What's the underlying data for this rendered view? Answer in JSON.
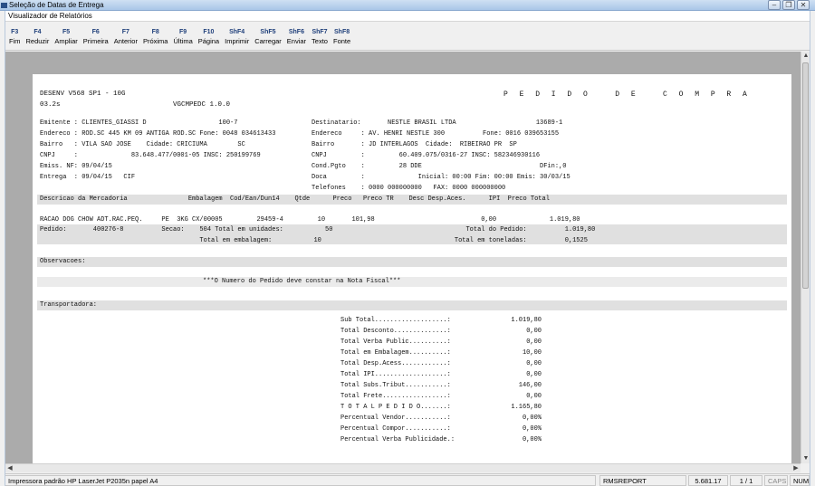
{
  "outer_title": "Seleção de Datas de Entrega",
  "window_title": "Visualizador de Relatórios",
  "toolbar": [
    {
      "key": "F3",
      "label": "Fim"
    },
    {
      "key": "F4",
      "label": "Reduzir"
    },
    {
      "key": "F5",
      "label": "Ampliar"
    },
    {
      "key": "F6",
      "label": "Primeira"
    },
    {
      "key": "F7",
      "label": "Anterior"
    },
    {
      "key": "F8",
      "label": "Próxima"
    },
    {
      "key": "F9",
      "label": "Última"
    },
    {
      "key": "F10",
      "label": "Página"
    },
    {
      "key": "ShF4",
      "label": "Imprimir"
    },
    {
      "key": "ShF5",
      "label": "Carregar"
    },
    {
      "key": "ShF6",
      "label": "Enviar"
    },
    {
      "key": "ShF7",
      "label": "Texto"
    },
    {
      "key": "ShF8",
      "label": "Fonte"
    }
  ],
  "report": {
    "system": "DESENV V568 SP1 - 10G",
    "version": "03.2s",
    "program": "VGCMPEDC 1.0.0",
    "doc_title": "P E D I D O   D E   C O M P R A",
    "emitente_line": "Emitente : CLIENTES_GIASSI D                   100-7",
    "endereco_line": "Endereco : ROD.SC 445 KM 09 ANTIGA ROD.SC Fone: 0048 034613433",
    "bairro_line": "Bairro   : VILA SAO JOSE    Cidade: CRICIUMA        SC",
    "cnpj_line": "CNPJ     :              83.648.477/0001-05 INSC: 250199769",
    "emiss_line": "Emiss. NF: 09/04/15",
    "entrega_line": "Entrega  : 09/04/15   CIF",
    "dest_line": "Destinatario:       NESTLE BRASIL LTDA                     13689-1",
    "dest_end_line": "Endereco     : AV. HENRI NESTLE 300          Fone: 0016 039653155",
    "dest_bairro_line": "Bairro       : JD INTERLAGOS  Cidade:  RIBEIRAO PR  SP",
    "dest_cnpj_line": "CNPJ         :         60.409.075/0316-27 INSC: 582346930116",
    "condpgto_line": "Cond.Pgto    :         28 DDE                               DFin:,0",
    "doca_line": "Doca         :              Inicial: 00:00 Fim: 00:00 Emis: 30/03/15",
    "telefones_line": "Telefones    : 0000 000000000   FAX: 0000 000000000",
    "columns_line": "Descricao da Mercadoria                Embalagem  Cod/Ean/Dun14    Qtde      Preco   Preco TR    Desc Desp.Aces.      IPI  Preco Total",
    "item_line": "RACAO DOG CHOW ADT.RAC.PEQ.     PE  3KG CX/00005         29459-4         10       101,98                            0,00              1.019,80",
    "pedido_line": "Pedido:       400276-8          Secao:    504 Total em unidades:           50                                   Total do Pedido:          1.019,80",
    "embalagem_line": "                                          Total em embalagem:           10                                   Total em toneladas:          0,1525",
    "obs_label": "Observacoes:",
    "obs_text": "***O Numero do Pedido deve constar na Nota Fiscal***",
    "transp_label": "Transportadora:",
    "totals": [
      {
        "label": "Sub Total...................:",
        "value": "1.019,80"
      },
      {
        "label": "Total Desconto..............:",
        "value": "0,00"
      },
      {
        "label": "Total Verba Public..........:",
        "value": "0,00"
      },
      {
        "label": "Total em Embalagem..........:",
        "value": "10,00"
      },
      {
        "label": "Total Desp.Acess............:",
        "value": "0,00"
      },
      {
        "label": "Total IPI...................:",
        "value": "0,00"
      },
      {
        "label": "Total Subs.Tribut...........:",
        "value": "146,00"
      },
      {
        "label": "Total Frete.................:",
        "value": "0,00"
      },
      {
        "label": "T O T A L P E D I D O.......:",
        "value": "1.165,80"
      },
      {
        "label": "Percentual Vendor...........:",
        "value": "0,00%"
      },
      {
        "label": "Percentual Compor...........:",
        "value": "0,00%"
      },
      {
        "label": "Percentual Verba Publicidade.:",
        "value": "0,00%"
      }
    ]
  },
  "status": {
    "printer": "Impressora padrão HP LaserJet P2035n papel A4",
    "module": "RMSREPORT",
    "number": "5.681.17",
    "page": "1 / 1",
    "caps": "CAPS",
    "num": "NUM"
  }
}
